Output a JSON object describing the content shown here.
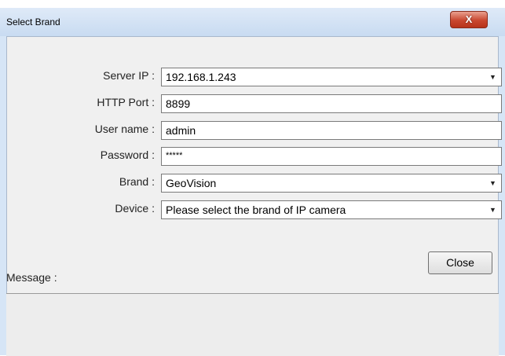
{
  "window": {
    "title": "Select Brand",
    "close_glyph": "X"
  },
  "form": {
    "server_ip": {
      "label": "Server IP :",
      "value": "192.168.1.243"
    },
    "http_port": {
      "label": "HTTP Port :",
      "value": "8899"
    },
    "user_name": {
      "label": "User name :",
      "value": "admin"
    },
    "password": {
      "label": "Password :",
      "value": "*****"
    },
    "brand": {
      "label": "Brand :",
      "value": "GeoVision"
    },
    "device": {
      "label": "Device :",
      "value": "Please select the brand of IP camera"
    }
  },
  "buttons": {
    "close": "Close"
  },
  "message": {
    "label": "Message :",
    "text": ""
  },
  "icons": {
    "dropdown": "chevron-down-icon",
    "close": "close-icon"
  },
  "colors": {
    "titlebar": "#c8dbf1",
    "close_button": "#c9472f",
    "client_bg": "#f0f0f0"
  }
}
